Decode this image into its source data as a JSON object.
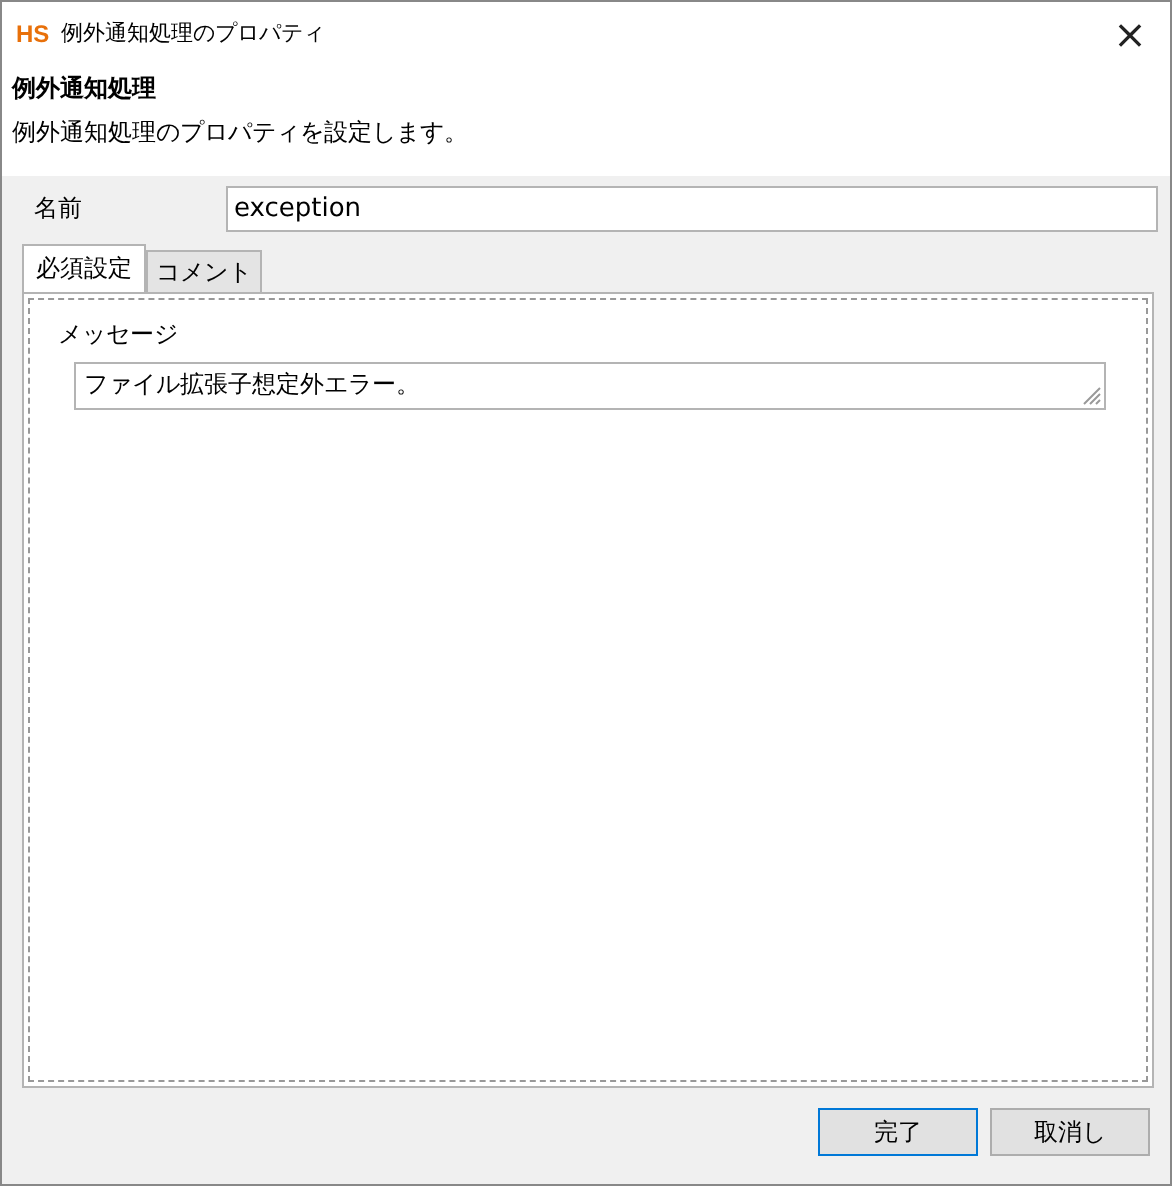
{
  "window": {
    "logo": "HS",
    "title": "例外通知処理のプロパティ",
    "close": "×"
  },
  "header": {
    "title": "例外通知処理",
    "description": "例外通知処理のプロパティを設定します。"
  },
  "name_field": {
    "label": "名前",
    "value": "exception"
  },
  "tabs": [
    {
      "label": "必須設定",
      "selected": true
    },
    {
      "label": "コメント",
      "selected": false
    }
  ],
  "message_field": {
    "label": "メッセージ",
    "value": "ファイル拡張子想定外エラー。"
  },
  "buttons": [
    {
      "label": "完了",
      "kind": "default"
    },
    {
      "label": "取消し",
      "kind": "normal"
    }
  ]
}
